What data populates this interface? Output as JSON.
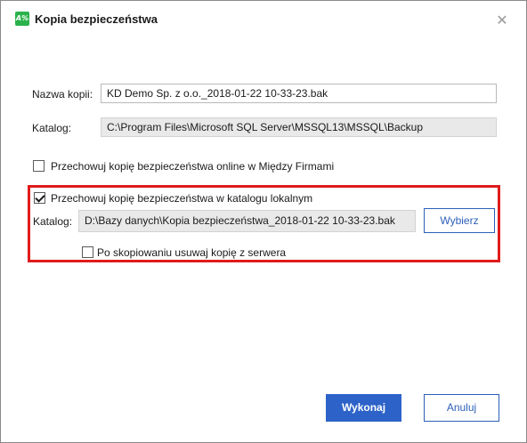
{
  "window": {
    "title": "Kopia bezpieczeństwa",
    "app_icon_text": "A%",
    "close_glyph": "✕"
  },
  "form": {
    "backup_name_label": "Nazwa kopii:",
    "backup_name_value": "KD Demo Sp. z o.o._2018-01-22 10-33-23.bak",
    "catalog_label": "Katalog:",
    "catalog_value": "C:\\Program Files\\Microsoft SQL Server\\MSSQL13\\MSSQL\\Backup"
  },
  "options": {
    "online_backup": {
      "label": "Przechowuj kopię bezpieczeństwa online w Między Firmami",
      "checked": false
    },
    "local_backup": {
      "label": "Przechowuj kopię bezpieczeństwa w katalogu lokalnym",
      "checked": true
    },
    "local_catalog_label": "Katalog:",
    "local_catalog_value": "D:\\Bazy danych\\Kopia bezpieczeństwa_2018-01-22 10-33-23.bak",
    "choose_button": "Wybierz",
    "delete_after_copy": {
      "label": "Po skopiowaniu usuwaj kopię z serwera",
      "checked": false
    }
  },
  "footer": {
    "execute_button": "Wykonaj",
    "cancel_button": "Anuluj"
  },
  "colors": {
    "highlight_border": "#e01b1b",
    "primary_button": "#2d63c8",
    "app_icon": "#2bb24c"
  }
}
